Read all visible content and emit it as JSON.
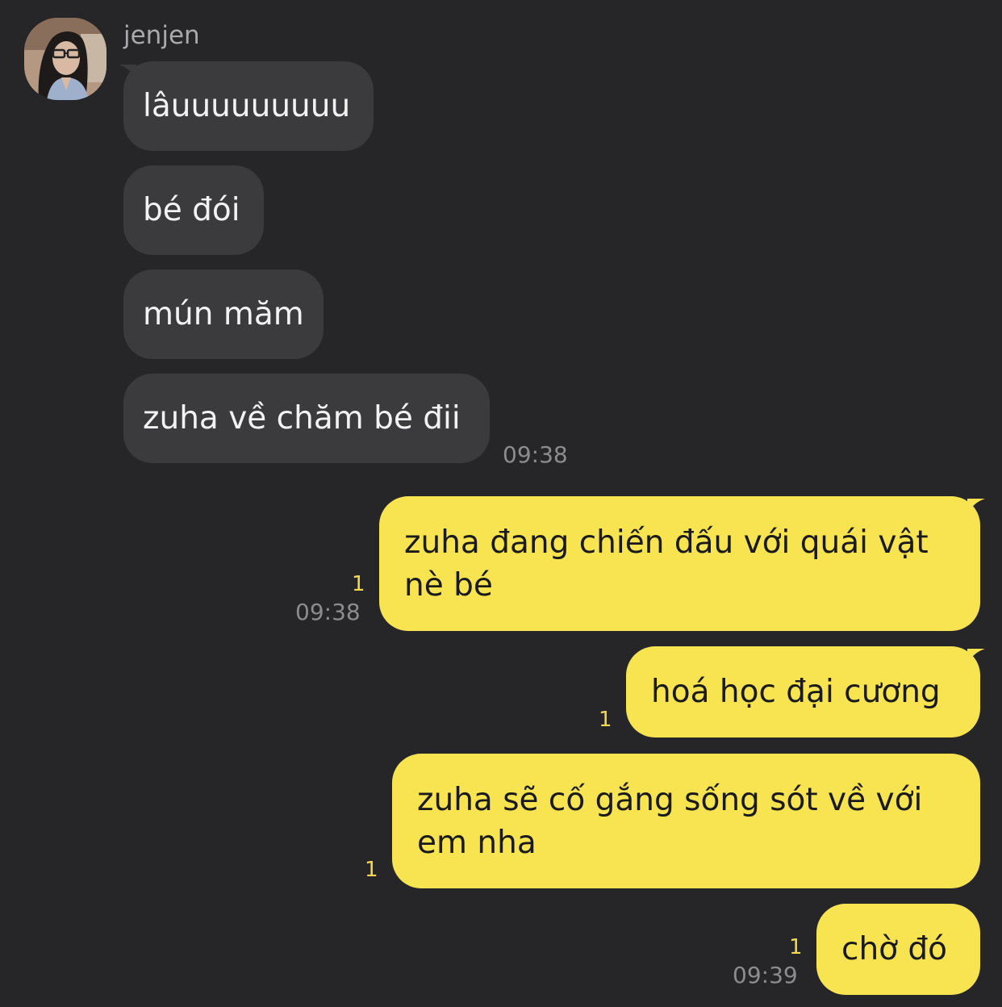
{
  "chat": {
    "contact": {
      "name": "jenjen",
      "avatar_icon": "profile-photo"
    },
    "colors": {
      "background": "#262628",
      "incoming_bubble": "#3b3b3d",
      "outgoing_bubble": "#f8e351",
      "unread_count": "#f4d949"
    },
    "incoming": [
      {
        "text": "lâuuuuuuuuu"
      },
      {
        "text": "bé đói"
      },
      {
        "text": "mún măm"
      },
      {
        "text": "zuha về chăm bé đii",
        "time": "09:38"
      }
    ],
    "outgoing": [
      {
        "text": "zuha đang chiến đấu với quái vật nè bé",
        "unread": "1",
        "time": "09:38"
      },
      {
        "text": "hoá học đại cương",
        "unread": "1"
      },
      {
        "text": "zuha sẽ cố gắng sống sót về với em nha",
        "unread": "1"
      },
      {
        "text": "chờ đó",
        "unread": "1",
        "time": "09:39"
      }
    ]
  }
}
